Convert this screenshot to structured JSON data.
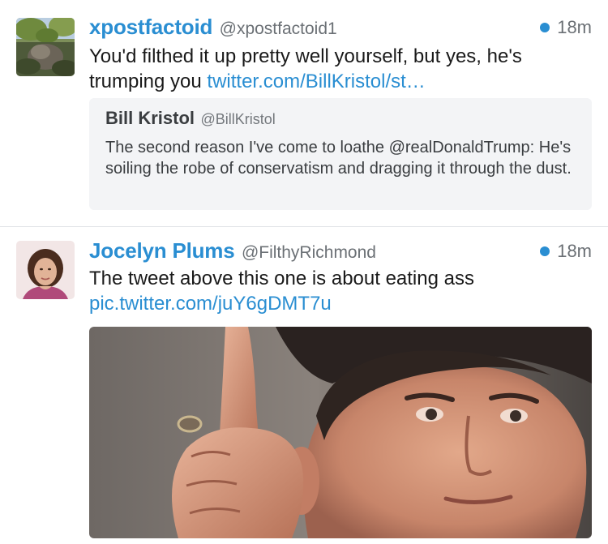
{
  "tweets": [
    {
      "display_name": "xpostfactoid",
      "handle": "@xpostfactoid1",
      "time": "18m",
      "text": "You'd filthed it up pretty well yourself, but yes, he's trumping you ",
      "link": "twitter.com/BillKristol/st…",
      "avatar_icon": "landscape-photo-avatar",
      "quoted": {
        "display_name": "Bill Kristol",
        "handle": "@BillKristol",
        "text": "The second reason I've come to loathe @realDonaldTrump: He's soiling the robe of conservatism and dragging it through the dust."
      }
    },
    {
      "display_name": "Jocelyn Plums",
      "handle": "@FilthyRichmond",
      "time": "18m",
      "text": "The tweet above this one is about eating ass",
      "link": "pic.twitter.com/juY6gDMT7u",
      "avatar_icon": "woman-portrait-avatar",
      "media_icon": "man-pointing-finger-photo"
    }
  ],
  "colors": {
    "link": "#2a8ed2",
    "unread_dot": "#2a8ed2",
    "quote_bg": "#f3f4f6",
    "divider": "#e3e5e8"
  }
}
